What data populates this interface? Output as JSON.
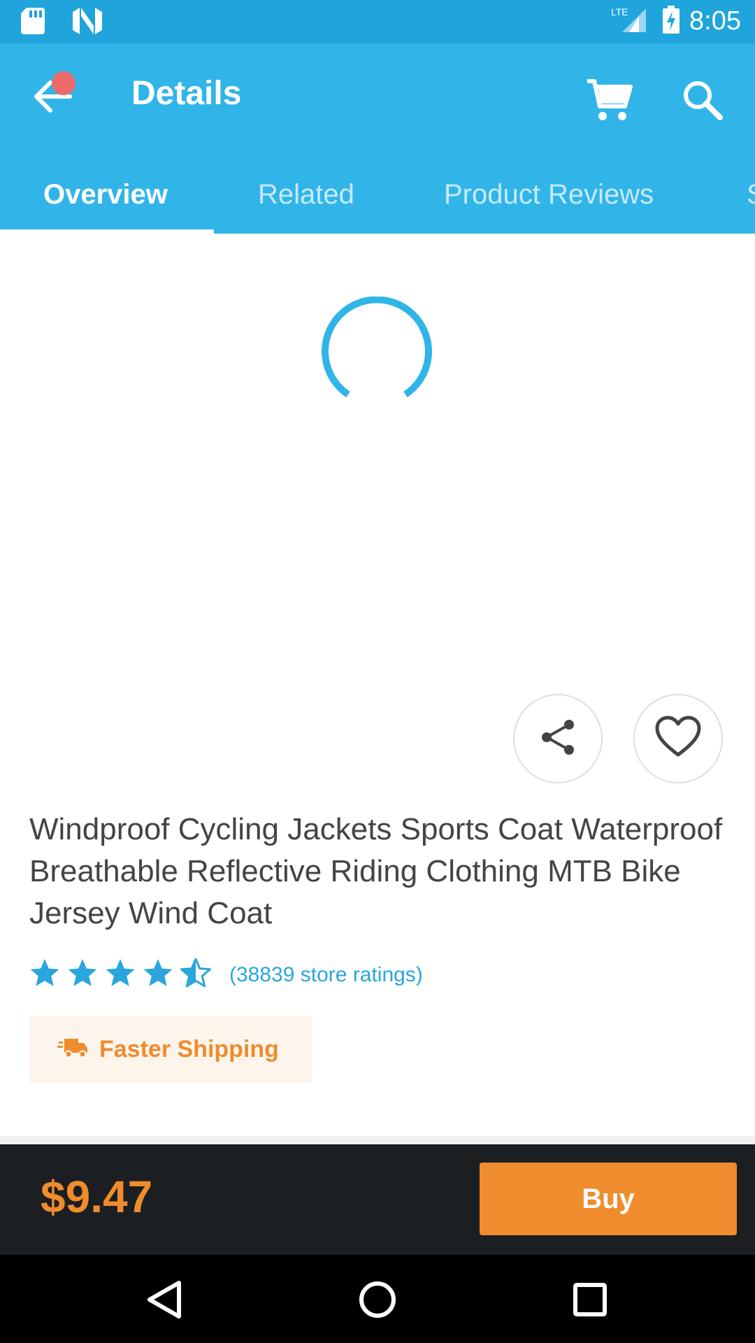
{
  "status_bar": {
    "time": "8:05",
    "network_label": "LTE",
    "icons": [
      "sd-card-icon",
      "n-logo-icon",
      "signal-icon",
      "battery-charging-icon"
    ]
  },
  "app_bar": {
    "title": "Details",
    "back_icon": "arrow-left-icon",
    "cart_icon": "cart-icon",
    "search_icon": "search-icon",
    "accent": "#31b5e8"
  },
  "tabs": [
    {
      "label": "Overview",
      "active": true
    },
    {
      "label": "Related",
      "active": false
    },
    {
      "label": "Product Reviews",
      "active": false
    },
    {
      "label": "S",
      "active": false
    }
  ],
  "loading": true,
  "product": {
    "title": "Windproof Cycling Jackets Sports Coat Waterproof Breathable Reflective Riding Clothing MTB Bike Jersey Wind Coat",
    "rating": 4.5,
    "rating_max": 5,
    "rating_count_text": "(38839 store ratings)",
    "shipping_label": "Faster Shipping",
    "shipping_icon": "truck-icon"
  },
  "actions": {
    "share_icon": "share-icon",
    "wishlist_icon": "heart-icon"
  },
  "bottom_bar": {
    "price": "$9.47",
    "buy_label": "Buy",
    "buy_color": "#ef8c2d"
  },
  "nav_bar": {
    "icons": [
      "back-triangle-icon",
      "home-circle-icon",
      "recents-square-icon"
    ]
  }
}
